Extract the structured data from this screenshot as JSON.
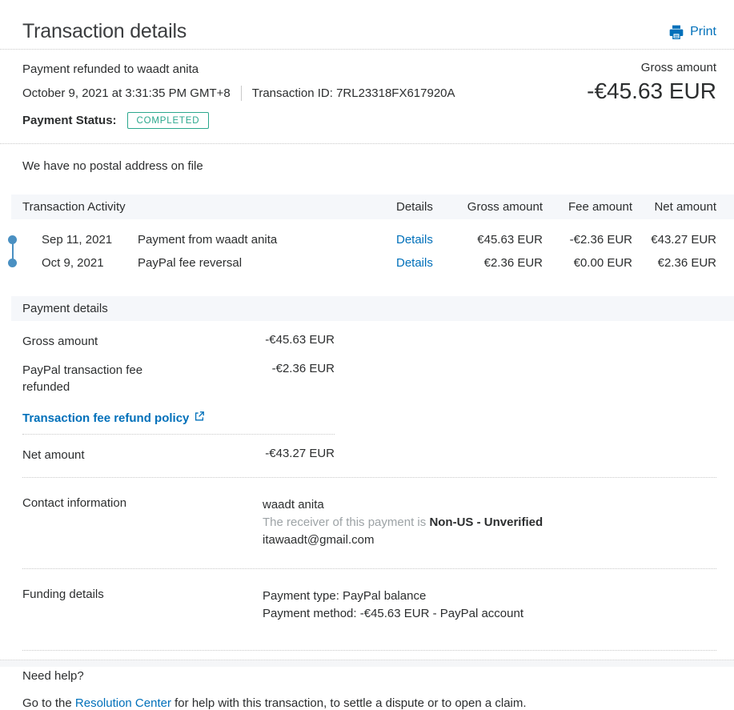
{
  "page": {
    "title": "Transaction details",
    "print_label": "Print"
  },
  "summary": {
    "payment_title": "Payment refunded to waadt anita",
    "date": "October 9, 2021 at 3:31:35 PM GMT+8",
    "transaction_id_label": "Transaction ID:",
    "transaction_id": "7RL23318FX617920A",
    "payment_status_label": "Payment Status:",
    "payment_status": "COMPLETED",
    "gross_amount_label": "Gross amount",
    "gross_amount": "-€45.63 EUR"
  },
  "postal_note": "We have no postal address on file",
  "activity": {
    "title": "Transaction Activity",
    "columns": {
      "details": "Details",
      "gross": "Gross amount",
      "fee": "Fee amount",
      "net": "Net amount"
    },
    "rows": [
      {
        "date": "Sep 11, 2021",
        "description": "Payment from waadt anita",
        "details_label": "Details",
        "gross": "€45.63 EUR",
        "fee": "-€2.36 EUR",
        "net": "€43.27 EUR"
      },
      {
        "date": "Oct 9, 2021",
        "description": "PayPal fee reversal",
        "details_label": "Details",
        "gross": "€2.36 EUR",
        "fee": "€0.00 EUR",
        "net": "€2.36 EUR"
      }
    ]
  },
  "payment_details": {
    "title": "Payment details",
    "gross_row": {
      "label": "Gross amount",
      "value": "-€45.63 EUR"
    },
    "fee_row": {
      "label": "PayPal transaction fee refunded",
      "value": "-€2.36 EUR"
    },
    "policy_link": "Transaction fee refund policy",
    "net_row": {
      "label": "Net amount",
      "value": "-€43.27 EUR"
    }
  },
  "contact": {
    "label": "Contact information",
    "name": "waadt anita",
    "receiver_prefix": "The receiver of this payment is",
    "receiver_status": "Non-US - Unverified",
    "email": "itawaadt@gmail.com"
  },
  "funding": {
    "label": "Funding details",
    "payment_type": "Payment type: PayPal balance",
    "payment_method": "Payment method: -€45.63 EUR - PayPal account"
  },
  "help": {
    "title": "Need help?",
    "prefix": "Go to the",
    "link": "Resolution Center",
    "suffix": "for help with this transaction, to settle a dispute or to open a claim."
  },
  "colors": {
    "link_blue": "#0070ba",
    "badge_teal": "#2ba78d",
    "text_dark": "#2c2e2f",
    "muted_gray": "#9da3a6",
    "section_bar_bg": "#f5f7fa",
    "timeline_blue": "#4a90c2"
  }
}
